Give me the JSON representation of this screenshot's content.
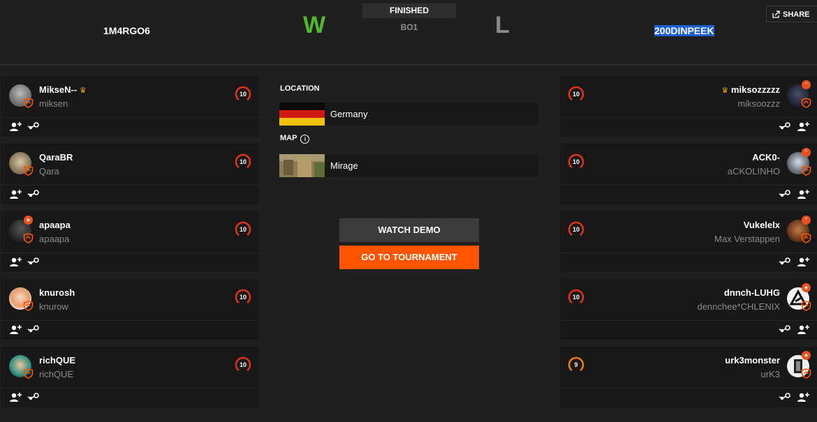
{
  "header": {
    "team_left": "1M4RGO6",
    "team_right": "200DINPEEK",
    "result_left": "W",
    "result_right": "L",
    "status": "FINISHED",
    "format": "BO1",
    "share_label": "SHARE"
  },
  "colors": {
    "accent": "#ff5500",
    "win": "#54b82d",
    "lose": "#8a8a8a",
    "selection": "#1d5fd1"
  },
  "team1": [
    {
      "nick": "MikseN--",
      "crown": "♛",
      "sub": "miksen",
      "level": "10"
    },
    {
      "nick": "QaraBR",
      "sub": "Qara",
      "level": "10"
    },
    {
      "nick": "apaapa",
      "sub": "apaapa",
      "level": "10"
    },
    {
      "nick": "knurosh",
      "sub": "knurow",
      "level": "10"
    },
    {
      "nick": "richQUE",
      "sub": "richQUE",
      "level": "10"
    }
  ],
  "team2": [
    {
      "nick": "miksozzzzz",
      "crown": "♛",
      "sub": "miksoozzz",
      "level": "10"
    },
    {
      "nick": "ACK0-",
      "sub": "aCKOLINHO",
      "level": "10"
    },
    {
      "nick": "Vukelelx",
      "sub": "Max Verstappen",
      "level": "10"
    },
    {
      "nick": "dnnch-LUHG",
      "sub": "dennchee*CHLENIX",
      "level": "10"
    },
    {
      "nick": "urk3monster",
      "sub": "urK3",
      "level": "9"
    }
  ],
  "match": {
    "location_label": "LOCATION",
    "location": "Germany",
    "map_label": "MAP",
    "map": "Mirage",
    "watch_demo": "WATCH DEMO",
    "go_to_tournament": "GO TO TOURNAMENT"
  },
  "icons": {
    "share": "share-icon",
    "add_friend": "add-friend-icon",
    "steam": "steam-icon",
    "shield": "shield-badge-icon",
    "star": "star-badge-icon",
    "info": "info-icon",
    "flag": "germany-flag-icon"
  }
}
